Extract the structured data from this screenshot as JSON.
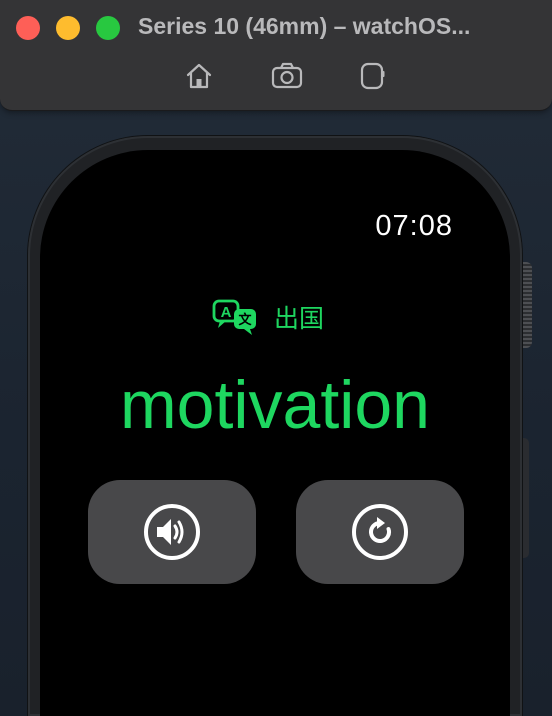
{
  "window": {
    "title": "Series 10 (46mm) – watchOS...",
    "toolbar": {
      "home_icon": "home-icon",
      "screenshot_icon": "camera-icon",
      "rotate_icon": "rotate-device-icon"
    }
  },
  "watch": {
    "time": "07:08",
    "context": {
      "icon": "translate-icon",
      "label": "出国"
    },
    "word": "motivation",
    "buttons": {
      "speak_icon": "speaker-icon",
      "next_icon": "refresh-icon"
    },
    "accent_color": "#1ed760"
  }
}
